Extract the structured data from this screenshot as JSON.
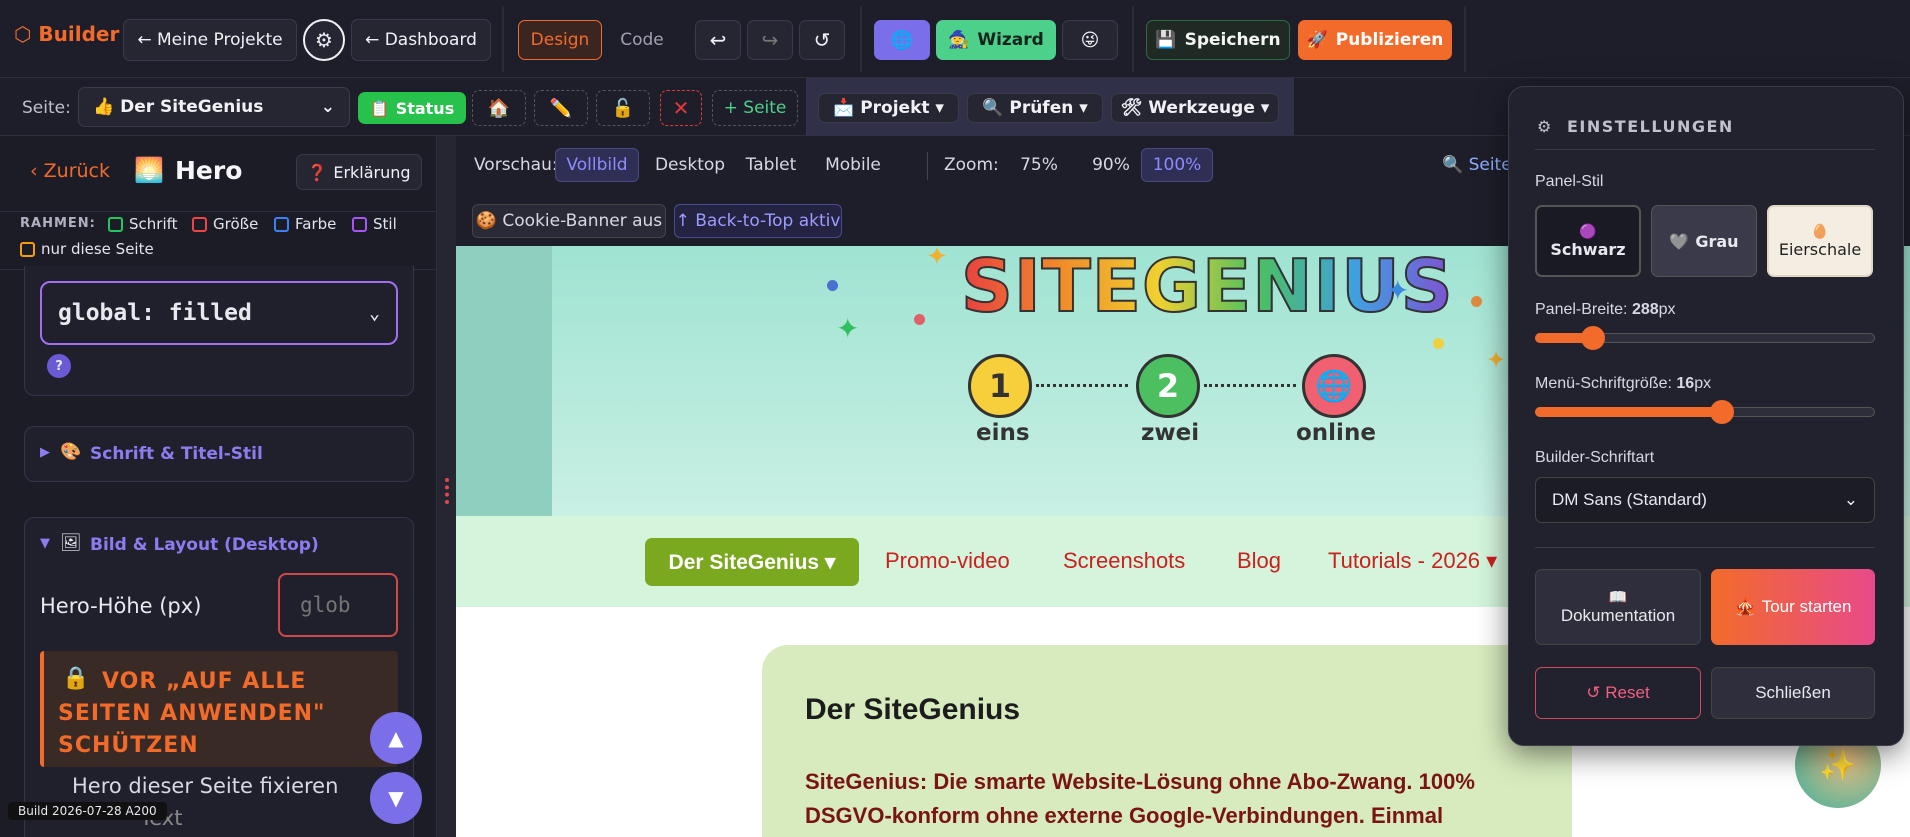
{
  "topbar": {
    "brand": "⬡ Builder",
    "my_projects": "← Meine Projekte",
    "dashboard": "← Dashboard",
    "design_tab": "Design",
    "code_tab": "Code",
    "wizard": "Wizard",
    "save": "Speichern",
    "publish": "Publizieren"
  },
  "subbar": {
    "page_label": "Seite:",
    "page_value": "👍 Der SiteGenius",
    "status": "Status",
    "add_page": "+ Seite",
    "project_menu": "Projekt ▾",
    "check_menu": "Prüfen ▾",
    "tools_menu": "Werkzeuge ▾"
  },
  "sidebar": {
    "back": "‹ Zurück",
    "title": "Hero",
    "explain": "Erklärung",
    "frames_label": "RAHMEN:",
    "frames": [
      {
        "label": "Schrift",
        "color": "#22c55e"
      },
      {
        "label": "Größe",
        "color": "#ef4444"
      },
      {
        "label": "Farbe",
        "color": "#3b82f6"
      },
      {
        "label": "Stil",
        "color": "#a855f7"
      },
      {
        "label": "nur diese Seite",
        "color": "#f59e0b"
      }
    ],
    "global_select": "global: filled",
    "help": "?",
    "font_section": "Schrift & Titel-Stil",
    "image_section": "Bild & Layout (Desktop)",
    "hero_height_label": "Hero-Höhe (px)",
    "hero_height_placeholder": "glob",
    "protect_warning": "VOR „AUF ALLE SEITEN ANWENDEN\" SCHÜTZEN",
    "fix_hero": "Hero dieser Seite fixieren",
    "build_info": "Build 2026-07-28 A200",
    "partial_text": "Text"
  },
  "preview_toolbar": {
    "preview_label": "Vorschau:",
    "modes": [
      "Vollbild",
      "Desktop",
      "Tablet",
      "Mobile"
    ],
    "active_mode": "Vollbild",
    "zoom_label": "Zoom:",
    "zooms": [
      "75%",
      "90%",
      "100%"
    ],
    "active_zoom": "100%",
    "search": "🔍 Seite",
    "cookie_badge": "🍪 Cookie-Banner aus",
    "backtop_badge": "↑ Back-to-Top aktiv"
  },
  "hero": {
    "logo": "SITEGENIUS",
    "steps": [
      {
        "num": "1",
        "label": "eins"
      },
      {
        "num": "2",
        "label": "zwei"
      },
      {
        "num": "🌐",
        "label": "online"
      }
    ]
  },
  "nav": {
    "active": "Der SiteGenius ▾",
    "links": [
      "Promo-video",
      "Screenshots",
      "Blog",
      "Tutorials - 2026 ▾"
    ]
  },
  "content": {
    "title": "Der SiteGenius",
    "text": "SiteGenius: Die smarte Website-Lösung ohne Abo-Zwang. 100% DSGVO-konform ohne externe Google-Verbindungen. Einmal"
  },
  "settings": {
    "title": "EINSTELLUNGEN",
    "panel_style_label": "Panel-Stil",
    "styles": [
      "Schwarz",
      "Grau",
      "Eierschale"
    ],
    "active_style": "Eierschale",
    "width_label": "Panel-Breite:",
    "width_value": "288",
    "width_unit": "px",
    "width_fraction": 0.17,
    "font_size_label": "Menü-Schriftgröße:",
    "font_size_value": "16",
    "font_size_unit": "px",
    "font_size_fraction": 0.55,
    "font_label": "Builder-Schriftart",
    "font_value": "DM Sans (Standard)",
    "docs": "Dokumentation",
    "tour": "Tour starten",
    "reset": "↺ Reset",
    "close": "Schließen"
  }
}
